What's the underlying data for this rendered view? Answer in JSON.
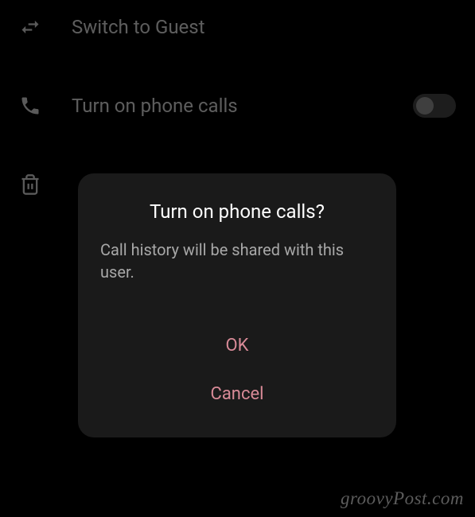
{
  "settings": {
    "items": [
      {
        "label": "Switch to Guest",
        "icon": "swap-icon"
      },
      {
        "label": "Turn on phone calls",
        "icon": "phone-icon",
        "has_toggle": true,
        "toggle_on": false
      },
      {
        "label": "",
        "icon": "trash-icon"
      }
    ]
  },
  "dialog": {
    "title": "Turn on phone calls?",
    "message": "Call history will be shared with this user.",
    "confirm_label": "OK",
    "cancel_label": "Cancel"
  },
  "watermark": "groovyPost.com"
}
